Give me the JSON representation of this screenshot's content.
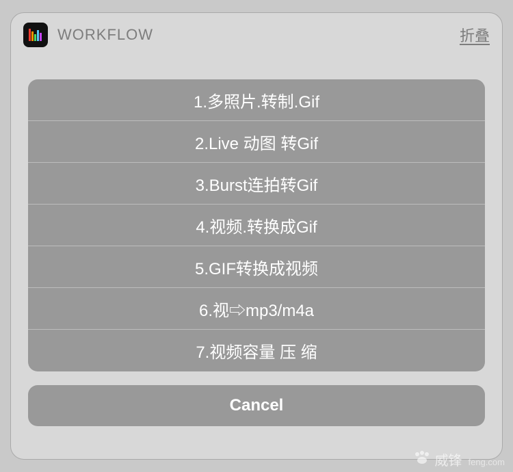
{
  "header": {
    "app_title": "WORKFLOW",
    "fold_label": "折叠"
  },
  "options": {
    "items": [
      {
        "label": "1.多照片.转制.Gif"
      },
      {
        "label": "2.Live 动图 转Gif"
      },
      {
        "label": "3.Burst连拍转Gif"
      },
      {
        "label": "4.视频.转换成Gif"
      },
      {
        "label": "5.GIF转换成视频"
      },
      {
        "label": "6.视⇨mp3/m4a"
      },
      {
        "label": "7.视频容量 压 缩"
      }
    ]
  },
  "cancel": {
    "label": "Cancel"
  },
  "watermark": {
    "name": "威锋",
    "site": "feng.com"
  }
}
